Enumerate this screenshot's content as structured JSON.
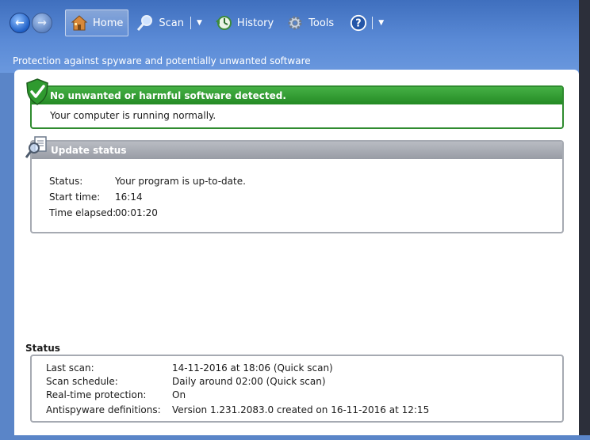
{
  "toolbar": {
    "back_icon": "back-arrow-icon",
    "forward_icon": "forward-arrow-icon",
    "home_label": "Home",
    "scan_label": "Scan",
    "history_label": "History",
    "tools_label": "Tools",
    "help_icon": "help-icon"
  },
  "subtitle": "Protection against spyware and potentially unwanted software",
  "ok_panel": {
    "heading": "No unwanted or harmful software detected.",
    "message": "Your computer is running normally."
  },
  "update_panel": {
    "heading": "Update status",
    "rows": [
      {
        "label": "Status:",
        "value": "Your program is up-to-date."
      },
      {
        "label": "Start time:",
        "value": "16:14"
      },
      {
        "label": "Time elapsed:",
        "value": "00:01:20"
      }
    ]
  },
  "status": {
    "title": "Status",
    "rows": [
      {
        "label": "Last scan:",
        "value": "14-11-2016 at 18:06 (Quick scan)"
      },
      {
        "label": "Scan schedule:",
        "value": "Daily around 02:00 (Quick scan)"
      },
      {
        "label": "Real-time protection:",
        "value": "On"
      },
      {
        "label": "Antispyware definitions:",
        "value": "Version 1.231.2083.0 created on 16-11-2016 at 12:15"
      }
    ]
  },
  "colors": {
    "chrome": "#4a7ccb",
    "ok_green": "#2f8b2f",
    "update_gray": "#a6aab2"
  }
}
